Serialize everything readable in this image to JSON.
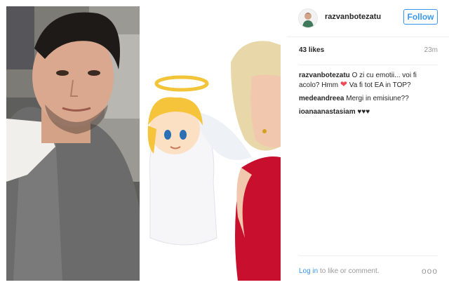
{
  "post": {
    "image_left": {
      "icon": "selfie-photo",
      "colors": {
        "jacket": "#6b6b6b",
        "wall": "#8a8a88",
        "skin": "#d9a88e"
      }
    },
    "image_right": {
      "icon": "angel-and-woman-photo",
      "colors": {
        "dress": "#c8102e",
        "hair": "#e8d7a8"
      }
    }
  },
  "header": {
    "username": "razvanbotezatu",
    "follow_label": "Follow",
    "accent_color": "#3897f0"
  },
  "stats": {
    "likes": "43 likes",
    "time": "23m"
  },
  "comments": [
    {
      "user": "razvanbotezatu",
      "text_before": "O zi cu emotii... voi fi acolo? Hmm",
      "icon": "heart-emoji",
      "text_after": "Va fi tot EA in TOP?"
    },
    {
      "user": "medeandreea",
      "text": "Mergi in emisiune??"
    },
    {
      "user": "ioanaanastasiam",
      "text": "♥♥♥"
    }
  ],
  "footer": {
    "login_link": "Log in",
    "login_text": "to like or comment.",
    "more_label": "ooo"
  }
}
